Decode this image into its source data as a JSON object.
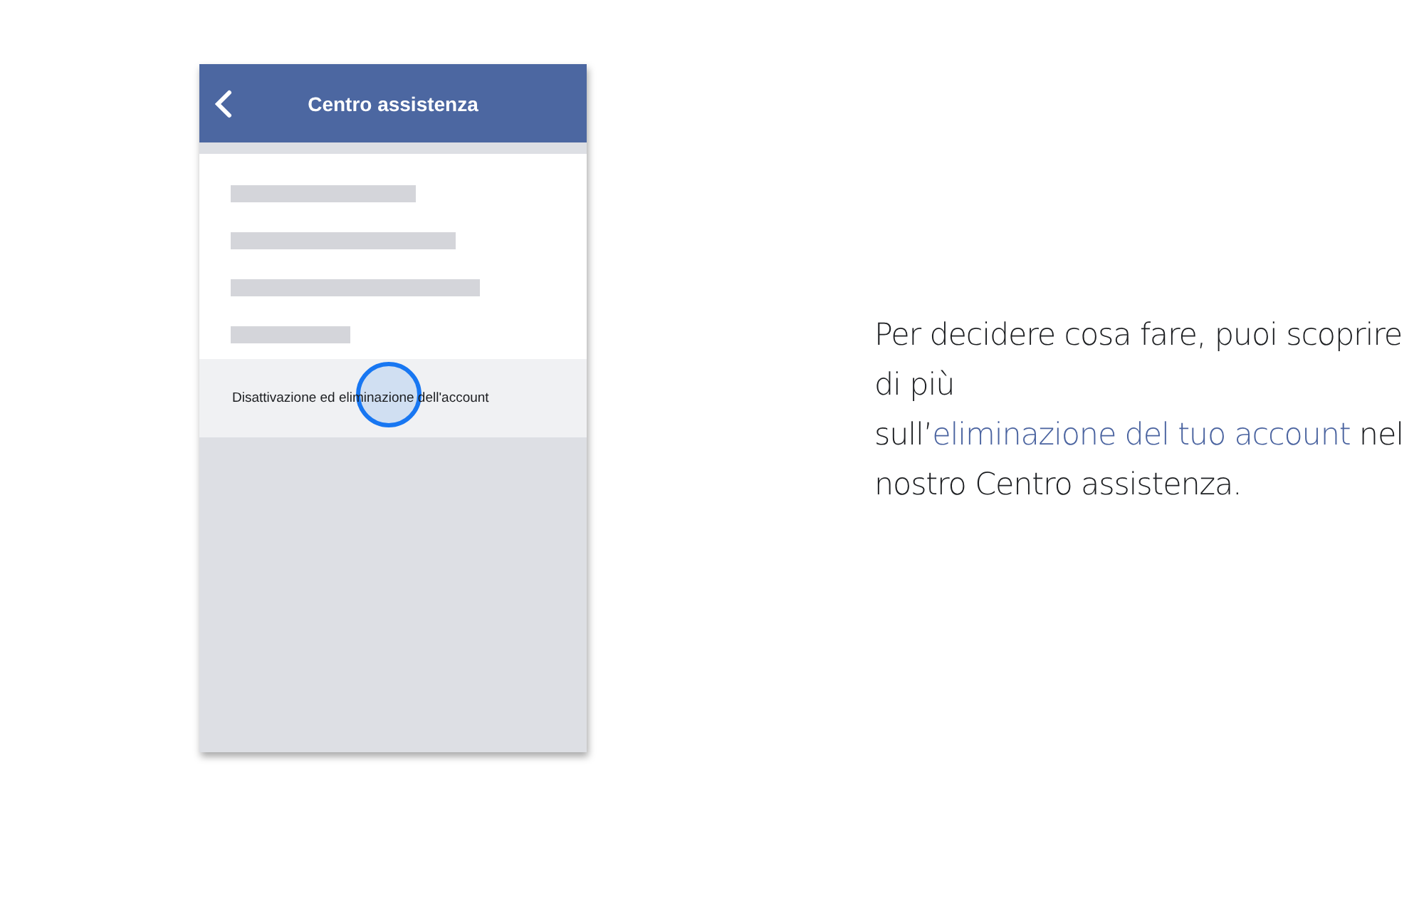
{
  "phone": {
    "header": {
      "title": "Centro assistenza"
    },
    "list_item": {
      "label": "Disattivazione ed eliminazione dell'account"
    }
  },
  "description": {
    "before": "Per decidere cosa fare, puoi scoprire di più sull’",
    "link": "eliminazione del tuo account",
    "after": " nel nostro Centro assistenza."
  }
}
